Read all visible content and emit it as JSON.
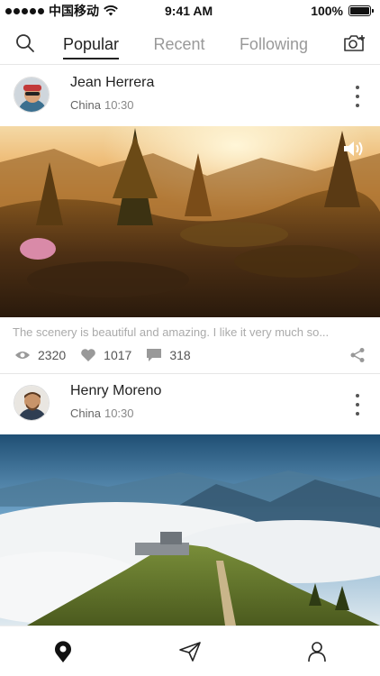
{
  "status_bar": {
    "carrier": "中国移动",
    "time": "9:41 AM",
    "battery": "100%"
  },
  "nav": {
    "tabs": [
      {
        "label": "Popular",
        "active": true
      },
      {
        "label": "Recent",
        "active": false
      },
      {
        "label": "Following",
        "active": false
      }
    ],
    "icons": {
      "search": "search-icon",
      "camera": "camera-add-icon"
    }
  },
  "posts": [
    {
      "author": "Jean Herrera",
      "location": "China",
      "time": "10:30",
      "caption": "The scenery is beautiful and amazing. I like it very much so...",
      "views": "2320",
      "likes": "1017",
      "comments": "318",
      "media_icon": "speaker-icon"
    },
    {
      "author": "Henry Moreno",
      "location": "China",
      "time": "10:30"
    }
  ],
  "bottom_nav": {
    "icons": [
      "location-pin-icon",
      "send-icon",
      "profile-icon"
    ]
  },
  "colors": {
    "accent": "#222222",
    "muted_text": "#999999",
    "divider": "#e6e6e6"
  }
}
